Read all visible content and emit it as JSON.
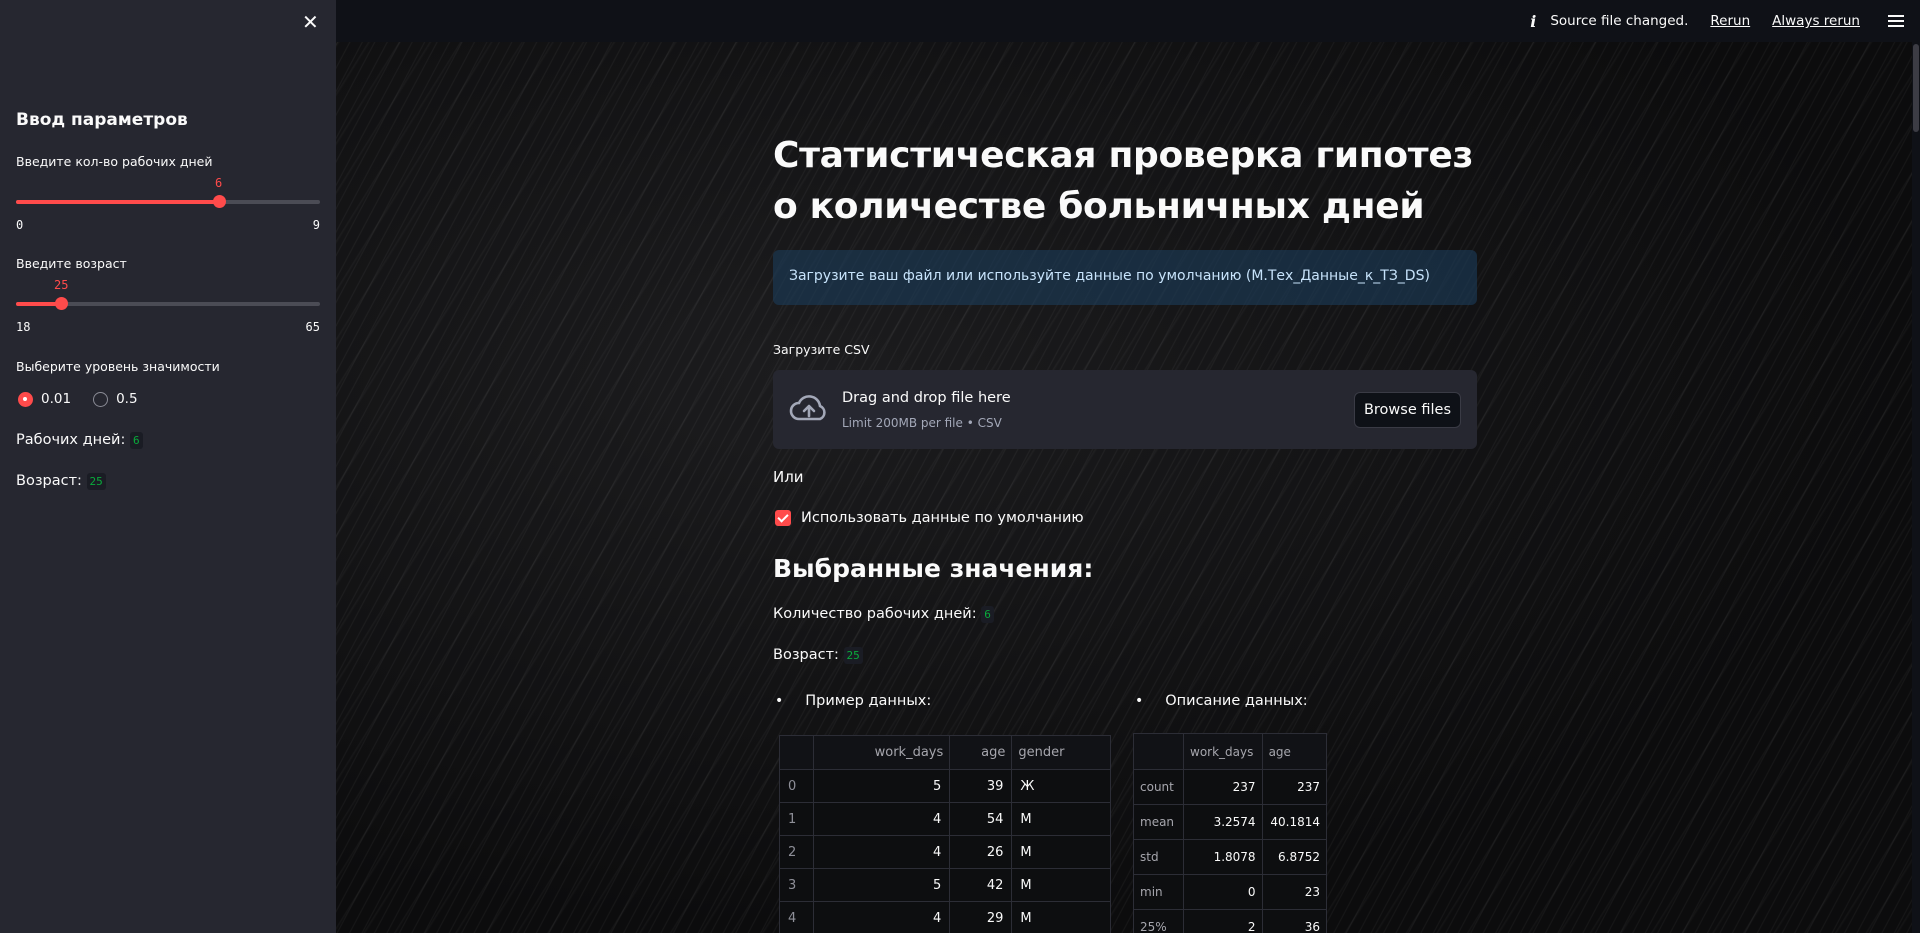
{
  "header": {
    "status_text": "Source file changed.",
    "rerun_label": "Rerun",
    "always_rerun_label": "Always rerun"
  },
  "sidebar": {
    "title": "Ввод параметров",
    "workdays_slider": {
      "label": "Введите кол-во рабочих дней",
      "value": "6",
      "min": "0",
      "max": "9",
      "fraction": 0.6667
    },
    "age_slider": {
      "label": "Введите возраст",
      "value": "25",
      "min": "18",
      "max": "65",
      "fraction": 0.149
    },
    "significance": {
      "label": "Выберите уровень значимости",
      "options": [
        "0.01",
        "0.5"
      ],
      "selected": "0.01"
    },
    "workdays_text": "Рабочих дней:",
    "workdays_value": "6",
    "age_text": "Возраст:",
    "age_value": "25"
  },
  "main": {
    "title_line1": "Статистическая проверка гипотез",
    "title_line2": "о количестве больничных дней",
    "info_alert": "Загрузите ваш файл или используйте данные по умолчанию (М.Тех_Данные_к_ТЗ_DS)",
    "uploader": {
      "label": "Загрузите CSV",
      "drag_text": "Drag and drop file here",
      "limit_text": "Limit 200MB per file • CSV",
      "browse_label": "Browse files"
    },
    "or_text": "Или",
    "default_checkbox": {
      "label": "Использовать данные по умолчанию",
      "checked": true
    },
    "selected_heading": "Выбранные значения:",
    "workdays_line": "Количество рабочих дней:",
    "workdays_value": "6",
    "age_line": "Возраст:",
    "age_value": "25",
    "sample_heading": "Пример данных:",
    "describe_heading": "Описание данных:",
    "sample_table": {
      "columns": [
        "",
        "work_days",
        "age",
        "gender"
      ],
      "rows": [
        [
          "0",
          "5",
          "39",
          "Ж"
        ],
        [
          "1",
          "4",
          "54",
          "М"
        ],
        [
          "2",
          "4",
          "26",
          "М"
        ],
        [
          "3",
          "5",
          "42",
          "М"
        ],
        [
          "4",
          "4",
          "29",
          "М"
        ]
      ]
    },
    "describe_table": {
      "columns": [
        "",
        "work_days",
        "age"
      ],
      "rows": [
        [
          "count",
          "237",
          "237"
        ],
        [
          "mean",
          "3.2574",
          "40.1814"
        ],
        [
          "std",
          "1.8078",
          "6.8752"
        ],
        [
          "min",
          "0",
          "23"
        ],
        [
          "25%",
          "2",
          "36"
        ]
      ]
    }
  },
  "colors": {
    "accent": "#ff4b4b",
    "sidebar_bg": "#262730",
    "code_green": "#09ab3b",
    "alert_text": "#c7e3fb"
  },
  "icons": [
    "close-icon",
    "info-icon",
    "hamburger-menu-icon",
    "cloud-upload-icon",
    "checkbox-checked-icon"
  ]
}
